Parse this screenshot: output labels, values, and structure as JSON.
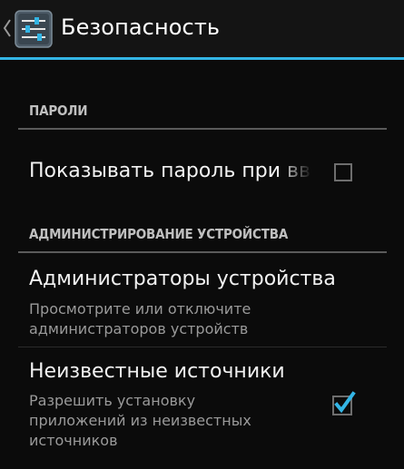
{
  "action_bar": {
    "title": "Безопасность",
    "back_icon": "chevron-left-icon",
    "app_icon": "settings-sliders-icon",
    "accent_color": "#33b5e5"
  },
  "sections": [
    {
      "header": "ПАРОЛИ",
      "items": [
        {
          "title": "Показывать пароль при вводе",
          "summary": "",
          "checkbox": false
        }
      ]
    },
    {
      "header": "АДМИНИСТРИРОВАНИЕ УСТРОЙСТВА",
      "items": [
        {
          "title": "Администраторы устройства",
          "summary_lines": [
            "Просмотрите или отключите",
            "администраторов устройств"
          ]
        },
        {
          "title": "Неизвестные источники",
          "summary_lines": [
            "Разрешить установку",
            "приложений из неизвестных",
            "источников"
          ],
          "checkbox": true
        }
      ]
    }
  ]
}
